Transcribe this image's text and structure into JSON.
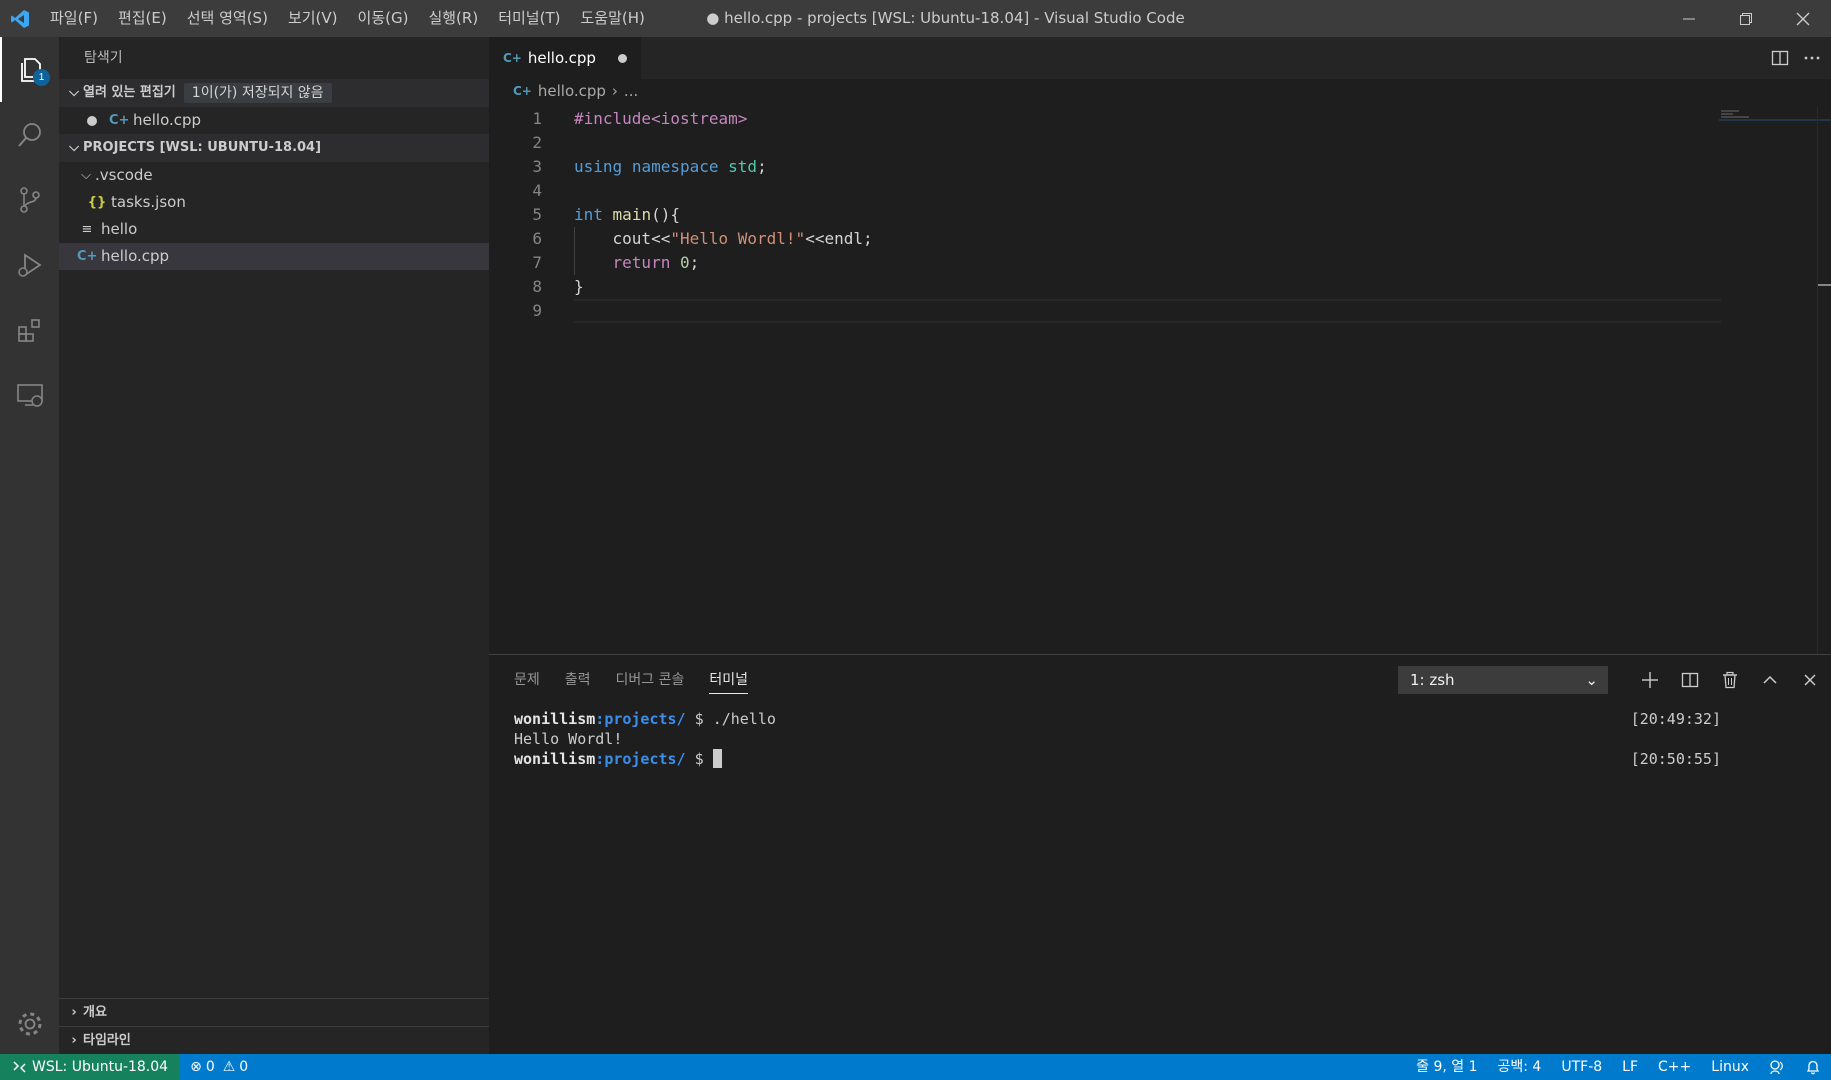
{
  "titlebar": {
    "menu": [
      "파일(F)",
      "편집(E)",
      "선택 영역(S)",
      "보기(V)",
      "이동(G)",
      "실행(R)",
      "터미널(T)",
      "도움말(H)"
    ],
    "window_title": "● hello.cpp - projects [WSL: Ubuntu-18.04] - Visual Studio Code"
  },
  "activitybar": {
    "explorer_badge": "1",
    "icons": [
      "explorer-icon",
      "search-icon",
      "source-control-icon",
      "run-debug-icon",
      "extensions-icon",
      "remote-explorer-icon",
      "settings-gear-icon"
    ]
  },
  "sidebar": {
    "title": "탐색기",
    "open_editors": {
      "label": "열려 있는 편집기",
      "dirty_badge": "1이(가) 저장되지 않음",
      "files": [
        "hello.cpp"
      ]
    },
    "workspace": {
      "label": "PROJECTS [WSL: UBUNTU-18.04]",
      "items": [
        {
          "name": ".vscode",
          "type": "folder"
        },
        {
          "name": "tasks.json",
          "type": "json"
        },
        {
          "name": "hello",
          "type": "file"
        },
        {
          "name": "hello.cpp",
          "type": "cpp"
        }
      ]
    },
    "outline_label": "개요",
    "timeline_label": "타임라인"
  },
  "editor": {
    "tab_label": "hello.cpp",
    "breadcrumb_file": "hello.cpp",
    "breadcrumb_more": "...",
    "line_numbers": [
      "1",
      "2",
      "3",
      "4",
      "5",
      "6",
      "7",
      "8",
      "9"
    ],
    "code": {
      "l1_directive": "#include<iostream>",
      "l3_using": "using",
      "l3_namespace": "namespace",
      "l3_std": "std",
      "l3_semi": ";",
      "l5_int": "int",
      "l5_main": "main",
      "l5_rest": "(){",
      "l6_indent": "    ",
      "l6_cout": "cout<<",
      "l6_str": "\"Hello Wordl!\"",
      "l6_rest": "<<endl;",
      "l7_indent": "    ",
      "l7_return": "return",
      "l7_space": " ",
      "l7_num": "0",
      "l7_semi": ";",
      "l8_close": "}"
    }
  },
  "panel": {
    "tabs": [
      "문제",
      "출력",
      "디버그 콘솔",
      "터미널"
    ],
    "active_tab": "터미널",
    "terminal_select": "1: zsh",
    "terminal": {
      "user": "wonillism",
      "colon": ":",
      "path": "projects/",
      "prompt": " $ ",
      "cmd1": "./hello",
      "time1": "[20:49:32]",
      "output1": "Hello Wordl!",
      "time2": "[20:50:55]"
    }
  },
  "statusbar": {
    "remote": "WSL: Ubuntu-18.04",
    "errors": "0",
    "warnings": "0",
    "position": "줄 9, 열 1",
    "spaces": "공백: 4",
    "encoding": "UTF-8",
    "eol": "LF",
    "language": "C++",
    "os": "Linux"
  },
  "colors": {
    "accent": "#007acc",
    "remote": "#16825d",
    "cpp_icon": "#519aba",
    "json_icon": "#cbcb41"
  }
}
